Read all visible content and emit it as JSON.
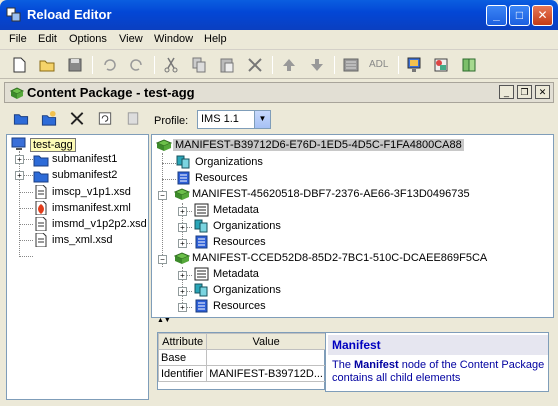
{
  "window": {
    "title": "Reload Editor"
  },
  "menu": [
    "File",
    "Edit",
    "Options",
    "View",
    "Window",
    "Help"
  ],
  "toolbar": {
    "icons": [
      "new-file-icon",
      "open-folder-icon",
      "save-icon",
      "undo-icon",
      "redo-icon",
      "cut-icon",
      "copy-icon",
      "paste-icon",
      "delete-icon",
      "move-up-icon",
      "move-down-icon",
      "metadata-icon",
      "adl-icon",
      "preview-icon",
      "package-icon",
      "book-icon"
    ],
    "adl_label": "ADL"
  },
  "content_package": {
    "title": "Content Package - test-agg"
  },
  "file_tree": {
    "root": "test-agg",
    "items": [
      {
        "label": "submanifest1",
        "type": "folder"
      },
      {
        "label": "submanifest2",
        "type": "folder"
      },
      {
        "label": "imscp_v1p1.xsd",
        "type": "xsd"
      },
      {
        "label": "imsmanifest.xml",
        "type": "xml"
      },
      {
        "label": "imsmd_v1p2p2.xsd",
        "type": "xsd"
      },
      {
        "label": "ims_xml.xsd",
        "type": "xsd"
      }
    ]
  },
  "profile": {
    "label": "Profile:",
    "value": "IMS 1.1"
  },
  "manifest_tree": {
    "root": "MANIFEST-B39712D6-E76D-1ED5-4D5C-F1FA4800CA88",
    "root_children": [
      "Organizations",
      "Resources"
    ],
    "sub1": {
      "label": "MANIFEST-45620518-DBF7-2376-AE66-3F13D0496735",
      "children": [
        "Metadata",
        "Organizations",
        "Resources"
      ]
    },
    "sub2": {
      "label": "MANIFEST-CCED52D8-85D2-7BC1-510C-DCAEE869F5CA",
      "children": [
        "Metadata",
        "Organizations",
        "Resources"
      ]
    }
  },
  "properties": {
    "headers": [
      "Attribute",
      "Value"
    ],
    "rows": [
      [
        "Base",
        ""
      ],
      [
        "Identifier",
        "MANIFEST-B39712D..."
      ]
    ]
  },
  "help": {
    "title": "Manifest",
    "text_pre": "The ",
    "text_bold": "Manifest",
    "text_post": " node of the Content Package contains all child elements"
  }
}
